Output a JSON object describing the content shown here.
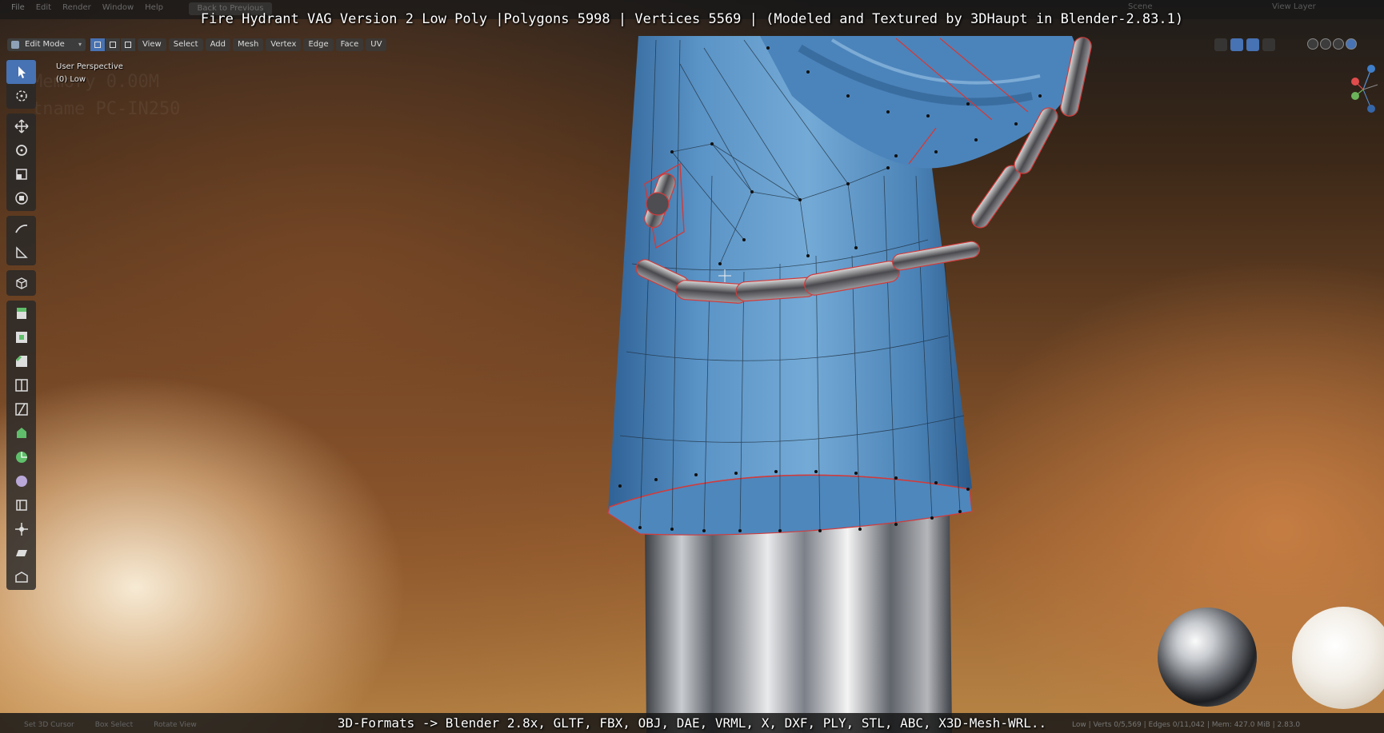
{
  "overlay": {
    "title": "Fire Hydrant VAG Version 2 Low Poly |Polygons 5998 | Vertices 5569 | (Modeled and Textured by 3DHaupt in Blender-2.83.1)",
    "formats": "3D-Formats -> Blender 2.8x, GLTF, FBX, OBJ, DAE, VRML, X, DXF, PLY, STL, ABC, X3D-Mesh-WRL.."
  },
  "topbar": {
    "menus": [
      "File",
      "Edit",
      "Render",
      "Window",
      "Help"
    ],
    "back_label": "Back to Previous",
    "scene_label": "Scene",
    "view_layer_label": "View Layer"
  },
  "header": {
    "mode": "Edit Mode",
    "menus": [
      "View",
      "Select",
      "Add",
      "Mesh",
      "Vertex",
      "Edge",
      "Face",
      "UV"
    ]
  },
  "viewport": {
    "perspective": "User Perspective",
    "object": "(0) Low",
    "ghost_line1": "Memory 0.00M",
    "ghost_line2": "tname PC-IN250"
  },
  "toolbar": {
    "tools": [
      "select-box",
      "cursor",
      "move",
      "rotate",
      "scale",
      "transform",
      "annotate",
      "measure",
      "add-cube",
      "extrude-region",
      "inset-faces",
      "bevel",
      "loop-cut",
      "knife",
      "poly-build",
      "spin",
      "smooth",
      "edge-slide",
      "shrink-fatten",
      "shear",
      "rip-region"
    ]
  },
  "status": {
    "left": [
      "Set 3D Cursor",
      "Box Select",
      "Rotate View"
    ],
    "right": "Low | Verts 0/5,569 | Edges 0/11,042 | Mem: 427.0 MiB | 2.83.0"
  },
  "colors": {
    "pipe_blue": "#5e96c6",
    "chain_red": "#d23a3a",
    "accent": "#4772b3"
  }
}
